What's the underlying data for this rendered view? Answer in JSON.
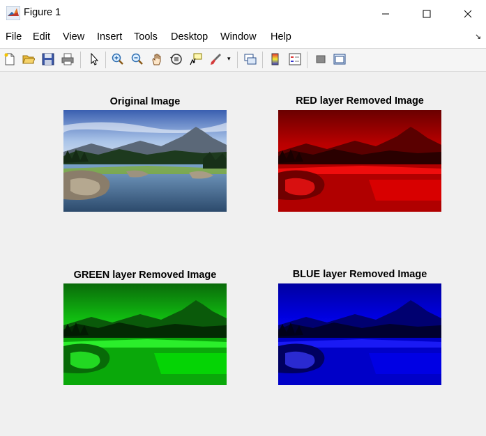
{
  "window": {
    "title": "Figure 1"
  },
  "menu": {
    "items": [
      {
        "label": "File"
      },
      {
        "label": "Edit"
      },
      {
        "label": "View"
      },
      {
        "label": "Insert"
      },
      {
        "label": "Tools"
      },
      {
        "label": "Desktop"
      },
      {
        "label": "Window"
      },
      {
        "label": "Help"
      }
    ]
  },
  "toolbar": {
    "icons": [
      "new-figure-icon",
      "open-file-icon",
      "save-icon",
      "print-icon",
      "select-arrow-icon",
      "zoom-in-icon",
      "zoom-out-icon",
      "pan-hand-icon",
      "rotate-3d-icon",
      "data-cursor-icon",
      "brush-icon",
      "link-plot-icon",
      "colorbar-icon",
      "legend-icon",
      "hide-plot-tools-icon",
      "show-plot-tools-icon"
    ]
  },
  "subplots": [
    {
      "title": "Original Image",
      "variant": "original"
    },
    {
      "title": "RED layer Removed Image",
      "variant": "red",
      "color": "#ff0000"
    },
    {
      "title": "GREEN layer Removed Image",
      "variant": "green",
      "color": "#00ff00"
    },
    {
      "title": "BLUE layer Removed Image",
      "variant": "blue",
      "color": "#0000ff"
    }
  ]
}
